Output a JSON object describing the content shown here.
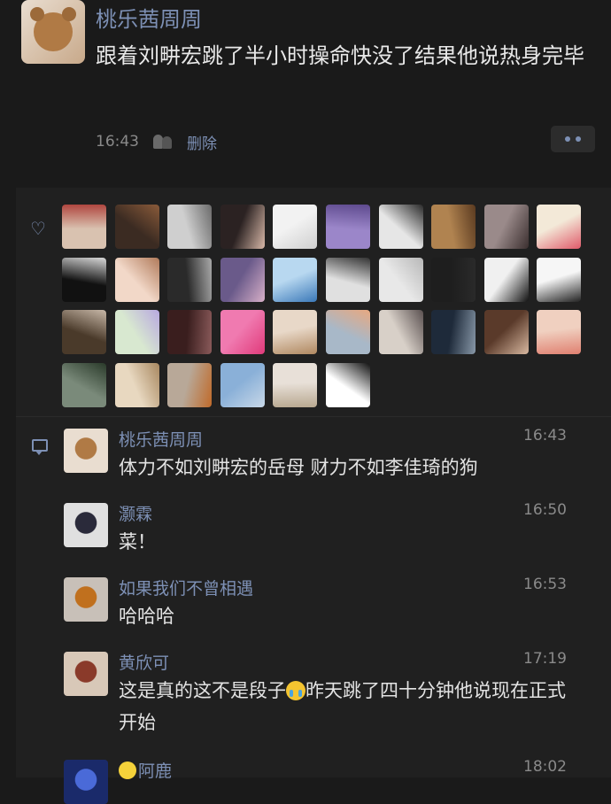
{
  "post": {
    "author": "桃乐茜周周",
    "text": "跟着刘畊宏跳了半小时操命快没了结果他说热身完毕",
    "time": "16:43",
    "delete_label": "删除"
  },
  "likes": {
    "count_icon": "heart-icon",
    "avatars": [
      {
        "c1": "#d9c2b0",
        "c2": "#b0463f"
      },
      {
        "c1": "#3b2b22",
        "c2": "#8a5b3a"
      },
      {
        "c1": "#cfcfcf",
        "c2": "#6b6b6b"
      },
      {
        "c1": "#2b2222",
        "c2": "#d8b8a8"
      },
      {
        "c1": "#f2f2f2",
        "c2": "#cfcfcf"
      },
      {
        "c1": "#9b86c9",
        "c2": "#5e4a8e"
      },
      {
        "c1": "#e6e6e6",
        "c2": "#2a2a2a"
      },
      {
        "c1": "#b08350",
        "c2": "#5a3a20"
      },
      {
        "c1": "#9a8a8a",
        "c2": "#3b2f2f"
      },
      {
        "c1": "#f3e9d8",
        "c2": "#e05a6a"
      },
      {
        "c1": "#111111",
        "c2": "#d8d8d8"
      },
      {
        "c1": "#f2d8c8",
        "c2": "#b07a5a"
      },
      {
        "c1": "#2a2a2a",
        "c2": "#a9a9a9"
      },
      {
        "c1": "#6a5a8a",
        "c2": "#d8b0c8"
      },
      {
        "c1": "#b8d8f0",
        "c2": "#3a78b8"
      },
      {
        "c1": "#e0e0e0",
        "c2": "#333333"
      },
      {
        "c1": "#e8e8e8",
        "c2": "#b8b8b8"
      },
      {
        "c1": "#1e1e1e",
        "c2": "#2a2a2a"
      },
      {
        "c1": "#f0f0f0",
        "c2": "#111111"
      },
      {
        "c1": "#f6f6f6",
        "c2": "#222222"
      },
      {
        "c1": "#4a3a2a",
        "c2": "#c8b8a8"
      },
      {
        "c1": "#d8e8d0",
        "c2": "#b8a8e0"
      },
      {
        "c1": "#3a1e1e",
        "c2": "#8a5a5a"
      },
      {
        "c1": "#f07ab0",
        "c2": "#e03a7a"
      },
      {
        "c1": "#e8d8c8",
        "c2": "#b08860"
      },
      {
        "c1": "#a8b8c8",
        "c2": "#e8a880"
      },
      {
        "c1": "#d8d0c8",
        "c2": "#5a5050"
      },
      {
        "c1": "#1e2a3a",
        "c2": "#8898a8"
      },
      {
        "c1": "#5a3a2a",
        "c2": "#d8b8a0"
      },
      {
        "c1": "#f0d0c0",
        "c2": "#e08070"
      },
      {
        "c1": "#7a8a7a",
        "c2": "#2a3a2a"
      },
      {
        "c1": "#e8d8c0",
        "c2": "#a88860"
      },
      {
        "c1": "#b8a898",
        "c2": "#c06a2a"
      },
      {
        "c1": "#8ab0d8",
        "c2": "#c8d8e8"
      },
      {
        "c1": "#e8e0d8",
        "c2": "#b8a890"
      },
      {
        "c1": "#ffffff",
        "c2": "#111111"
      }
    ]
  },
  "comments": [
    {
      "name": "桃乐茜周周",
      "time": "16:43",
      "text": "体力不如刘畊宏的岳母 财力不如李佳琦的狗",
      "c1": "#e9ddd0",
      "c2": "#b07a45"
    },
    {
      "name": "灏霖",
      "time": "16:50",
      "text": "菜！",
      "c1": "#e0e0e0",
      "c2": "#2a2a3a"
    },
    {
      "name": "如果我们不曾相遇",
      "time": "16:53",
      "text": "哈哈哈",
      "c1": "#c8c0b8",
      "c2": "#c0701e"
    },
    {
      "name": "黄欣可",
      "time": "17:19",
      "text_a": "这是真的这不是段子",
      "text_b": "昨天跳了四十分钟他说现在正式开始",
      "c1": "#d8c8b8",
      "c2": "#8a3a2a"
    },
    {
      "name": "阿鹿",
      "time": "18:02",
      "c1": "#1a2a6a",
      "c2": "#4a6ad8"
    }
  ]
}
